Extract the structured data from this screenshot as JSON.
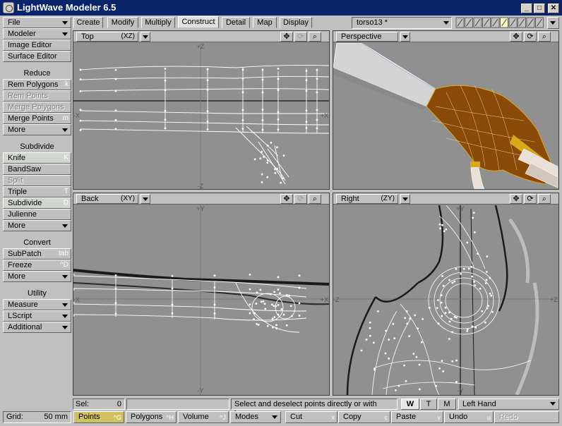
{
  "window": {
    "title": "LightWave Modeler 6.5",
    "minimize_glyph": "_",
    "maximize_glyph": "□",
    "close_glyph": "✕"
  },
  "sidebar": {
    "top_items": [
      {
        "label": "File",
        "type": "dropdown"
      },
      {
        "label": "Modeler",
        "type": "dropdown"
      },
      {
        "label": "Image Editor"
      },
      {
        "label": "Surface Editor"
      }
    ],
    "reduce": {
      "heading": "Reduce",
      "items": [
        {
          "label": "Rem Polygons",
          "shortcut": "k"
        },
        {
          "label": "Rem Points",
          "disabled": true
        },
        {
          "label": "Merge Polygons",
          "disabled": true
        },
        {
          "label": "Merge Points",
          "shortcut": "m"
        },
        {
          "label": "More",
          "type": "dropdown"
        }
      ]
    },
    "subdivide": {
      "heading": "Subdivide",
      "items": [
        {
          "label": "Knife",
          "shortcut": "K",
          "selected": true
        },
        {
          "label": "BandSaw"
        },
        {
          "label": "Split",
          "disabled": true
        },
        {
          "label": "Triple",
          "shortcut": "T"
        },
        {
          "label": "Subdivide",
          "shortcut": "D",
          "selected": true
        },
        {
          "label": "Julienne"
        },
        {
          "label": "More",
          "type": "dropdown"
        }
      ]
    },
    "convert": {
      "heading": "Convert",
      "items": [
        {
          "label": "SubPatch",
          "shortcut": "tab"
        },
        {
          "label": "Freeze",
          "shortcut": "^D"
        },
        {
          "label": "More",
          "type": "dropdown"
        }
      ]
    },
    "utility": {
      "heading": "Utility",
      "items": [
        {
          "label": "Measure",
          "type": "dropdown"
        },
        {
          "label": "LScript",
          "type": "dropdown"
        },
        {
          "label": "Additional",
          "type": "dropdown"
        }
      ]
    }
  },
  "tabs": [
    "Create",
    "Modify",
    "Multiply",
    "Construct",
    "Detail",
    "Map",
    "Display"
  ],
  "active_tab": "Construct",
  "object_selector": {
    "value": "torso13 *"
  },
  "viewports": [
    {
      "name": "Top",
      "axis": "(XZ)",
      "labels": {
        "top": "+Z",
        "bottom": "-Z",
        "left": "-X",
        "right": "+X"
      }
    },
    {
      "name": "Perspective",
      "axis": ""
    },
    {
      "name": "Back",
      "axis": "(XY)",
      "labels": {
        "top": "+Y",
        "bottom": "-Y",
        "left": "-X",
        "right": "+X"
      }
    },
    {
      "name": "Right",
      "axis": "(ZY)",
      "labels": {
        "top": "+Y",
        "bottom": "-Y",
        "left": "-Z",
        "right": "+Z"
      }
    }
  ],
  "viewport_tools": {
    "move": "✥",
    "rotate": "⟳",
    "zoom": "⌕"
  },
  "status": {
    "sel_label": "Sel:",
    "sel_value": "0",
    "message": "Select and deselect points directly or with lasso.",
    "wtm": [
      "W",
      "T",
      "M"
    ],
    "wtm_active": "W",
    "hand": "Left Hand"
  },
  "grid": {
    "label": "Grid:",
    "value": "50 mm"
  },
  "bottom_bar": [
    {
      "label": "Points",
      "shortcut": "^G",
      "active": true
    },
    {
      "label": "Polygons",
      "shortcut": "^H"
    },
    {
      "label": "Volume",
      "shortcut": "^J"
    },
    {
      "label": "Modes",
      "type": "dropdown"
    },
    {
      "label": "Cut",
      "shortcut": "x"
    },
    {
      "label": "Copy",
      "shortcut": "c"
    },
    {
      "label": "Paste",
      "shortcut": "v"
    },
    {
      "label": "Undo",
      "shortcut": "u"
    },
    {
      "label": "Redo",
      "disabled": true
    }
  ],
  "colors": {
    "viewport_bg": "#909090",
    "wire": "#ffffff",
    "skin": "#d8d8d8",
    "glove": "#8a4a08",
    "gold": "#d8a818",
    "titlebar": "#0a246a"
  }
}
